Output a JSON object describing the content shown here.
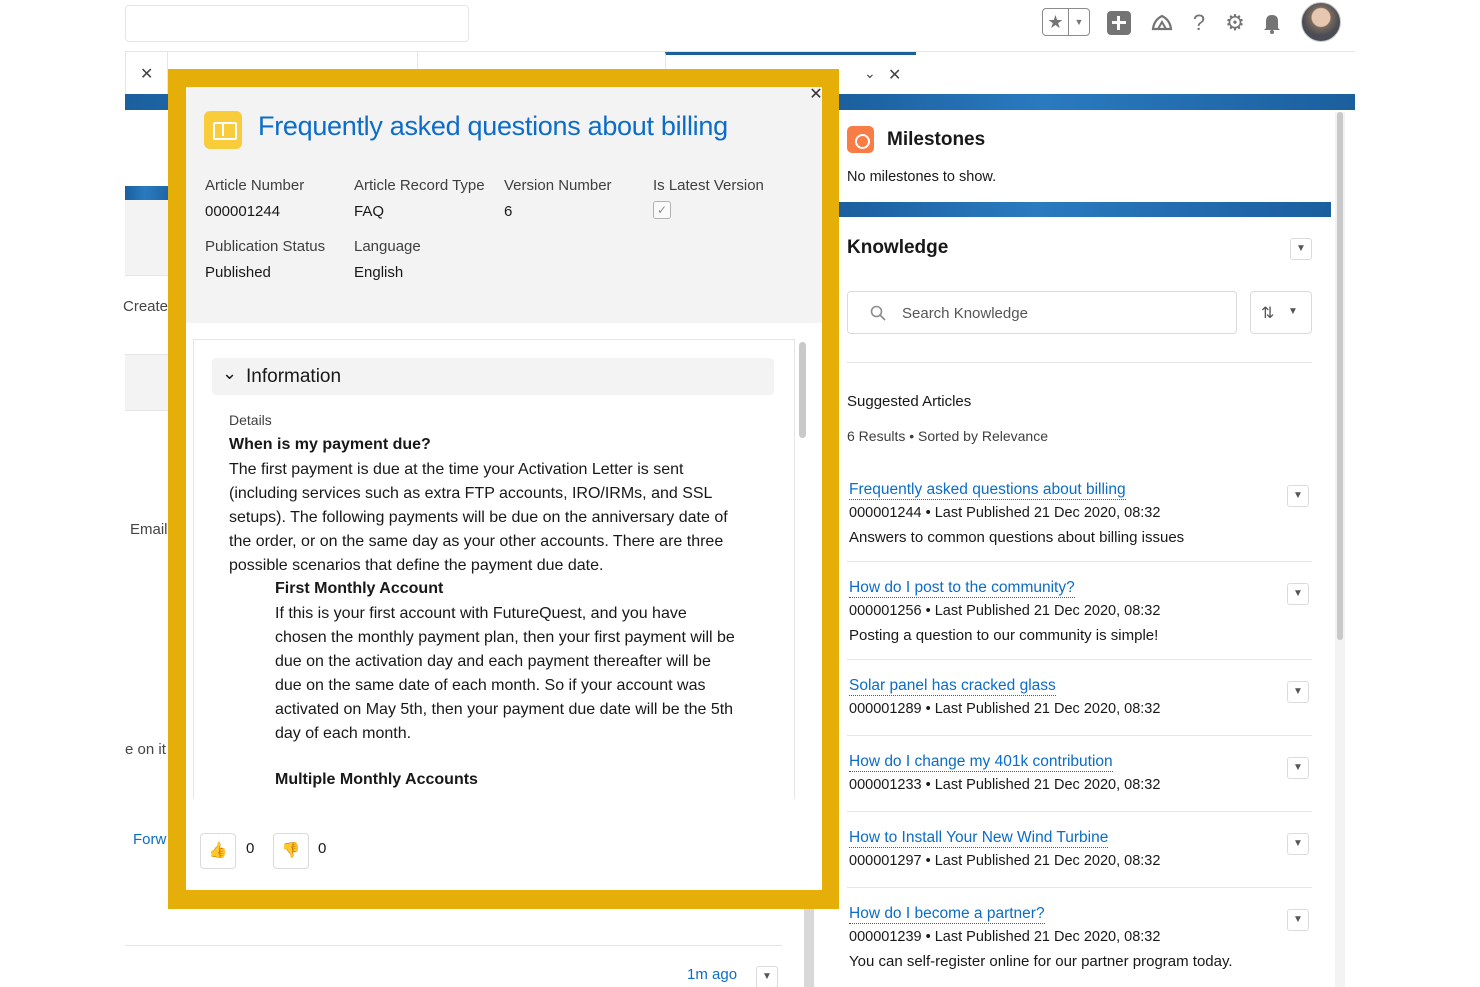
{
  "header": {
    "favorites_icon": "star-icon",
    "add_icon": "plus-icon",
    "setup_assistant_icon": "trailhead-icon",
    "help_icon": "question-icon",
    "settings_icon": "gear-icon",
    "notifications_icon": "bell-icon"
  },
  "background": {
    "fragments": [
      "Create",
      "Email",
      "e on it",
      "Forw"
    ],
    "activity_time": "1m ago"
  },
  "modal": {
    "title": "Frequently asked questions about billing",
    "fields": [
      {
        "label": "Article Number",
        "value": "000001244"
      },
      {
        "label": "Article Record Type",
        "value": "FAQ"
      },
      {
        "label": "Version Number",
        "value": "6"
      },
      {
        "label": "Is Latest Version",
        "value": true
      },
      {
        "label": "Publication Status",
        "value": "Published"
      },
      {
        "label": "Language",
        "value": "English"
      }
    ],
    "section_label": "Information",
    "details_label": "Details",
    "question": "When is my payment due?",
    "paragraph_lines": [
      "The first payment is due at the time your Activation Letter is sent",
      "(including services such as extra FTP accounts, IRO/IRMs, and SSL",
      "setups). The following payments will be due on the anniversary date of",
      "the order, or on the same day as your other accounts. There are three",
      "possible scenarios that define the payment due date."
    ],
    "subheading_1": "First Monthly Account",
    "sub_paragraph_lines": [
      "If this is your first account with FutureQuest, and you have",
      "chosen the monthly payment plan, then your first payment will be",
      "due on the activation day and each payment thereafter will be",
      "due on the same date of each month. So if your account was",
      "activated on May 5th, then your payment due date will be the 5th",
      "day of each month."
    ],
    "subheading_2": "Multiple Monthly Accounts",
    "upvotes": "0",
    "downvotes": "0"
  },
  "milestones": {
    "title": "Milestones",
    "empty_text": "No milestones to show."
  },
  "knowledge": {
    "title": "Knowledge",
    "search_placeholder": "Search Knowledge",
    "suggested_label": "Suggested Articles",
    "results_text": "6 Results • Sorted by Relevance",
    "articles": [
      {
        "title": "Frequently asked questions about billing",
        "meta": "000001244  •  Last Published  21 Dec 2020, 08:32",
        "summary": "Answers to common questions about billing issues"
      },
      {
        "title": "How do I post to the community?",
        "meta": "000001256  •  Last Published  21 Dec 2020, 08:32",
        "summary": "Posting a question to our community is simple!"
      },
      {
        "title": "Solar panel has cracked glass",
        "meta": "000001289  •  Last Published  21 Dec 2020, 08:32",
        "summary": ""
      },
      {
        "title": "How do I change my 401k contribution",
        "meta": "000001233  •  Last Published  21 Dec 2020, 08:32",
        "summary": ""
      },
      {
        "title": "How to Install Your New Wind Turbine",
        "meta": "000001297  •  Last Published  21 Dec 2020, 08:32",
        "summary": ""
      },
      {
        "title": "How do I become a partner?",
        "meta": "000001239  •  Last Published  21 Dec 2020, 08:32",
        "summary": "You can self-register online for our partner program today."
      }
    ]
  },
  "colors": {
    "highlight_frame": "#e5ae08",
    "link": "#0b6cc9",
    "brand_band": "#1b5f9e",
    "milestones_icon": "#f77c46",
    "article_icon": "#f8cc3b"
  }
}
